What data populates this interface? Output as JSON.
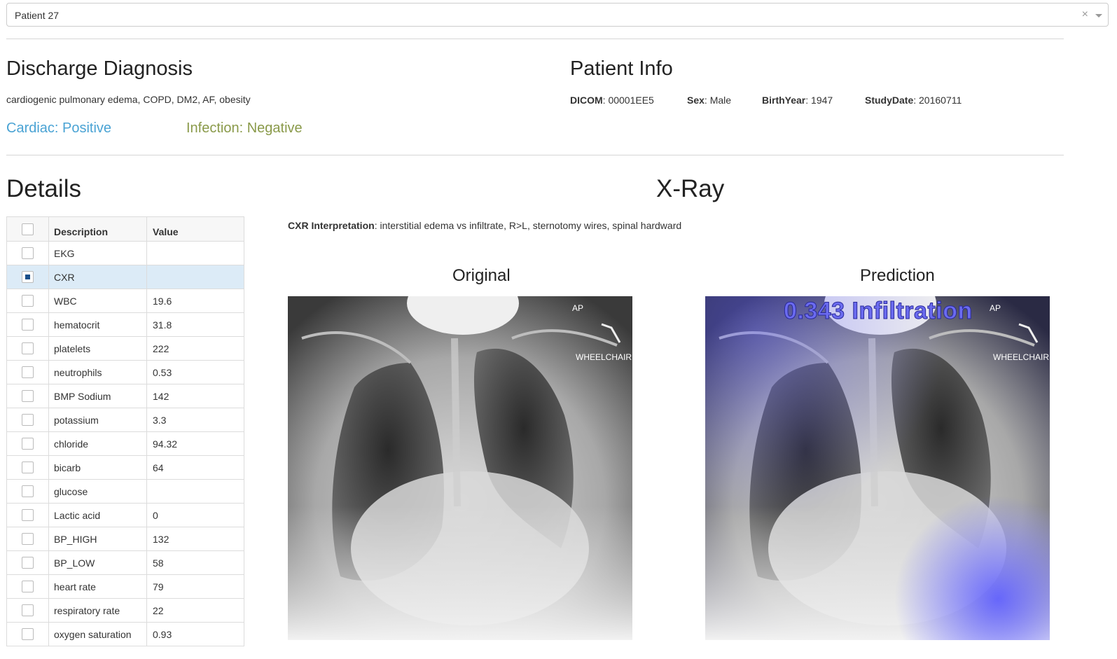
{
  "patient_select": {
    "value": "Patient 27",
    "clear_symbol": "×"
  },
  "diagnosis": {
    "title": "Discharge Diagnosis",
    "text": "cardiogenic pulmonary edema, COPD, DM2, AF, obesity",
    "cardiac": "Cardiac: Positive",
    "infection": "Infection: Negative"
  },
  "patient_info": {
    "title": "Patient Info",
    "dicom_label": "DICOM",
    "dicom_value": ": 00001EE5",
    "sex_label": "Sex",
    "sex_value": ": Male",
    "birthyear_label": "BirthYear",
    "birthyear_value": ": 1947",
    "studydate_label": "StudyDate",
    "studydate_value": ": 20160711"
  },
  "details": {
    "title": "Details",
    "columns": [
      "Description",
      "Value"
    ],
    "rows": [
      {
        "desc": "EKG",
        "value": "",
        "checked": false
      },
      {
        "desc": "CXR",
        "value": "",
        "checked": true
      },
      {
        "desc": "WBC",
        "value": "19.6",
        "checked": false
      },
      {
        "desc": "hematocrit",
        "value": "31.8",
        "checked": false
      },
      {
        "desc": "platelets",
        "value": "222",
        "checked": false
      },
      {
        "desc": "neutrophils",
        "value": "0.53",
        "checked": false
      },
      {
        "desc": "BMP Sodium",
        "value": "142",
        "checked": false
      },
      {
        "desc": "potassium",
        "value": "3.3",
        "checked": false
      },
      {
        "desc": "chloride",
        "value": "94.32",
        "checked": false
      },
      {
        "desc": "bicarb",
        "value": "64",
        "checked": false
      },
      {
        "desc": "glucose",
        "value": "",
        "checked": false
      },
      {
        "desc": "Lactic acid",
        "value": "0",
        "checked": false
      },
      {
        "desc": "BP_HIGH",
        "value": "132",
        "checked": false
      },
      {
        "desc": "BP_LOW",
        "value": "58",
        "checked": false
      },
      {
        "desc": "heart rate",
        "value": "79",
        "checked": false
      },
      {
        "desc": "respiratory rate",
        "value": "22",
        "checked": false
      },
      {
        "desc": "oxygen saturation",
        "value": "0.93",
        "checked": false
      }
    ]
  },
  "xray": {
    "title": "X-Ray",
    "interp_label": "CXR Interpretation",
    "interp_text": ": interstitial edema vs infiltrate, R>L, sternotomy wires, spinal hardward",
    "original_title": "Original",
    "prediction_title": "Prediction",
    "marker_ap": "AP",
    "marker_wheelchair": "WHEELCHAIR",
    "prediction_label": "0.343 Infiltration"
  },
  "colors": {
    "cardiac": "#4aa3d4",
    "infection": "#8a9a4a",
    "selected_row": "#dcebf7",
    "heatmap": "#5a5aff"
  }
}
